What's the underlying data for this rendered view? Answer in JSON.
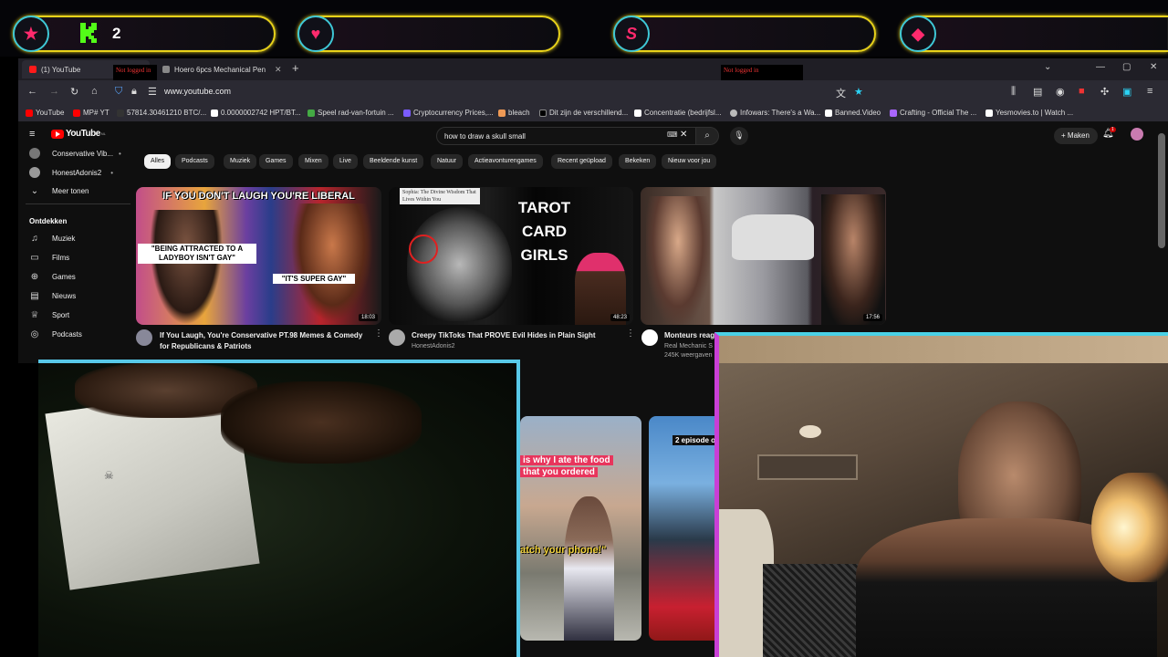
{
  "overlay": {
    "kick_count": "2",
    "colors": {
      "pill_border": "#e8d21a",
      "bubble_border": "#3ec7d6",
      "star": "#ff2a6d",
      "heart": "#ff2a6d",
      "kick": "#53fc18"
    }
  },
  "browser": {
    "tabs": [
      {
        "label": "(1) YouTube"
      },
      {
        "label": "Hoero 6pcs Mechanical Pencils"
      }
    ],
    "not_logged_in_label": "Not logged in",
    "url": "www.youtube.com",
    "bookmarks": [
      "YouTube",
      "MP# YT",
      "57814.30461210 BTC/...",
      "0.0000002742 HPT/BT...",
      "Speel rad-van-fortuin ...",
      "Cryptocurrency Prices,...",
      "bleach",
      "Dit zijn de verschillend...",
      "Concentratie (bedrijfsl...",
      "Infowars: There's a Wa...",
      "Banned.Video",
      "Crafting - Official The ...",
      "Yesmovies.to | Watch ..."
    ]
  },
  "youtube": {
    "logo_text": "YouTube",
    "logo_region": "NL",
    "search_query": "how to draw a skull small",
    "create_label": "Maken",
    "notification_count": "1",
    "sidebar_subs": [
      {
        "label": "Conservative Vib..."
      },
      {
        "label": "HonestAdonis2"
      }
    ],
    "show_more": "Meer tonen",
    "explore_title": "Ontdekken",
    "explore_items": [
      {
        "label": "Muziek",
        "icon": "music-icon"
      },
      {
        "label": "Films",
        "icon": "film-icon"
      },
      {
        "label": "Games",
        "icon": "gamepad-icon"
      },
      {
        "label": "Nieuws",
        "icon": "news-icon"
      },
      {
        "label": "Sport",
        "icon": "trophy-icon"
      },
      {
        "label": "Podcasts",
        "icon": "podcast-icon"
      }
    ],
    "chips": [
      "Alles",
      "Podcasts",
      "Muziek",
      "Games",
      "Mixen",
      "Live",
      "Beeldende kunst",
      "Natuur",
      "Actieavonturengames",
      "Recent geüpload",
      "Bekeken",
      "Nieuw voor jou"
    ],
    "videos": [
      {
        "title_line1": "If You Laugh, You're Conservative PT.98 Memes & Comedy",
        "title_line2": "for Republicans & Patriots",
        "duration": "18:03",
        "thumb_banner": "IF YOU DON'T LAUGH YOU'RE LIBERAL",
        "thumb_quote1": "\"BEING ATTRACTED TO A LADYBOY ISN'T GAY\"",
        "thumb_quote2": "\"IT'S SUPER GAY\""
      },
      {
        "title_line1": "Creepy TikToks That PROVE Evil Hides in Plain Sight",
        "channel": "HonestAdonis2",
        "duration": "48:23",
        "thumb_caption": "Sophia: The Divine Wisdom That Lives Within You",
        "thumb_big_text": [
          "TAROT",
          "CARD",
          "GIRLS"
        ]
      },
      {
        "title_line1": "Monteurs reag",
        "channel": "Real Mechanic S",
        "views": "245K weergaven",
        "duration": "17:56"
      }
    ],
    "shorts": [
      {
        "caption1": "is why I ate the food",
        "caption2": "that you ordered",
        "caption3": "atch your phone!\""
      },
      {
        "caption1": "2 episode of"
      }
    ]
  }
}
